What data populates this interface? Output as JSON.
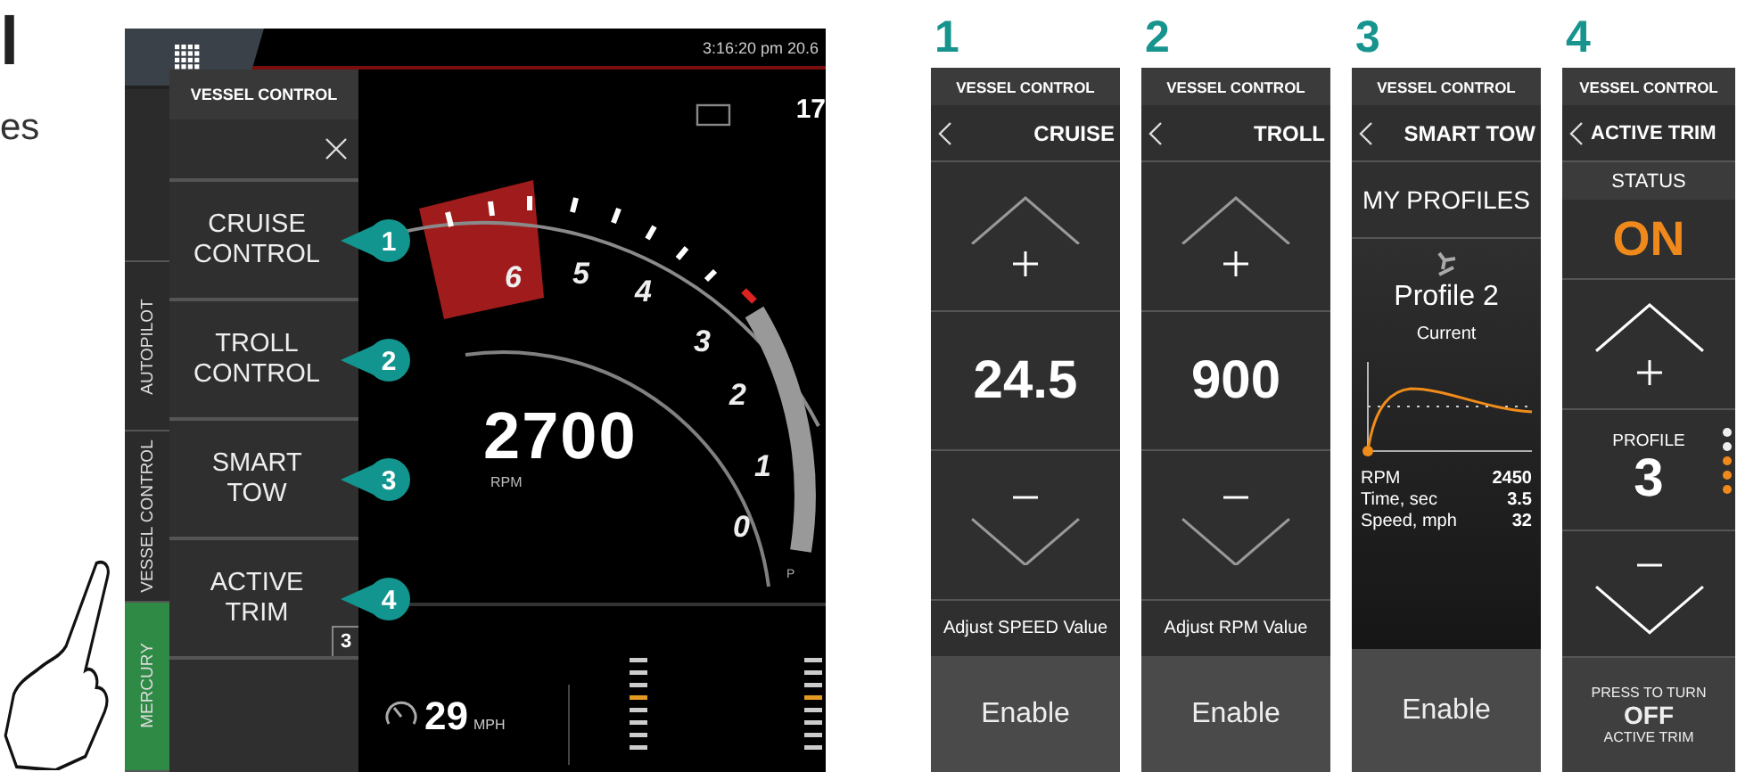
{
  "page_fragments": [
    {
      "text": "l",
      "kind": "heading"
    },
    {
      "text": "es",
      "kind": "body"
    }
  ],
  "main_screen": {
    "status_text": "3:16:20 pm 20.6",
    "top_value": "17",
    "side_tabs": [
      {
        "label": "AUTOPILOT",
        "color": "#2b2b2b"
      },
      {
        "label": "VESSEL CONTROL",
        "color": "#2b2b2b"
      },
      {
        "label": "MERCURY",
        "color": "#2f8a45"
      }
    ],
    "menu": {
      "title": "VESSEL CONTROL",
      "items": [
        {
          "label": "CRUISE CONTROL",
          "callout": "1"
        },
        {
          "label": "TROLL CONTROL",
          "callout": "2"
        },
        {
          "label": "SMART TOW",
          "callout": "3"
        },
        {
          "label": "ACTIVE TRIM",
          "callout": "4",
          "badge": "3"
        }
      ]
    },
    "gauge": {
      "value": "2700",
      "unit": "RPM",
      "scale": [
        "6",
        "5",
        "4",
        "3",
        "2",
        "1",
        "0"
      ],
      "end_mark": "P"
    },
    "speed": {
      "value": "29",
      "unit": "MPH"
    }
  },
  "panels": [
    {
      "number": "1",
      "kind": "stepper",
      "header": "VESSEL CONTROL",
      "title": "CRUISE",
      "value": "24.5",
      "hint": "Adjust SPEED Value",
      "button": "Enable"
    },
    {
      "number": "2",
      "kind": "stepper",
      "header": "VESSEL CONTROL",
      "title": "TROLL",
      "value": "900",
      "hint": "Adjust RPM Value",
      "button": "Enable"
    },
    {
      "number": "3",
      "kind": "profiles",
      "header": "VESSEL CONTROL",
      "title": "SMART TOW",
      "section": "MY PROFILES",
      "profile": "Profile 2",
      "status": "Current",
      "stats": [
        {
          "label": "RPM",
          "value": "2450"
        },
        {
          "label": "Time, sec",
          "value": "3.5"
        },
        {
          "label": "Speed, mph",
          "value": "32"
        }
      ],
      "button": "Enable"
    },
    {
      "number": "4",
      "kind": "trim",
      "header": "VESSEL CONTROL",
      "title": "ACTIVE TRIM",
      "status_label": "STATUS",
      "status": "ON",
      "profile_label": "PROFILE",
      "profile": "3",
      "level": 0.6,
      "action_top": "PRESS TO TURN",
      "action": "OFF",
      "action_bottom": "ACTIVE TRIM"
    }
  ]
}
